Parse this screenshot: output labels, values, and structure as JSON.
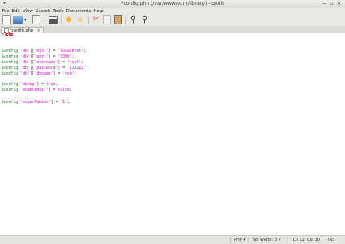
{
  "window": {
    "title": "*config.php (/var/www/vcm/library) - gedit"
  },
  "menu": [
    "File",
    "Edit",
    "View",
    "Search",
    "Tools",
    "Documents",
    "Help"
  ],
  "tab": {
    "label": "*config.php",
    "close": "×"
  },
  "code": {
    "lines": [
      [
        {
          "t": "kw",
          "v": "<?php"
        }
      ],
      [],
      [],
      [
        {
          "t": "var",
          "v": "$config"
        },
        {
          "t": "plain",
          "v": "["
        },
        {
          "t": "str",
          "v": "'db'"
        },
        {
          "t": "plain",
          "v": "]["
        },
        {
          "t": "str",
          "v": "'host'"
        },
        {
          "t": "plain",
          "v": "] = "
        },
        {
          "t": "str",
          "v": "'localhost'"
        },
        {
          "t": "plain",
          "v": ";"
        }
      ],
      [
        {
          "t": "var",
          "v": "$config"
        },
        {
          "t": "plain",
          "v": "["
        },
        {
          "t": "str",
          "v": "'db'"
        },
        {
          "t": "plain",
          "v": "]["
        },
        {
          "t": "str",
          "v": "'port'"
        },
        {
          "t": "plain",
          "v": "] = "
        },
        {
          "t": "str",
          "v": "'3306'"
        },
        {
          "t": "plain",
          "v": ";"
        }
      ],
      [
        {
          "t": "var",
          "v": "$config"
        },
        {
          "t": "plain",
          "v": "["
        },
        {
          "t": "str",
          "v": "'db'"
        },
        {
          "t": "plain",
          "v": "]["
        },
        {
          "t": "str",
          "v": "'username'"
        },
        {
          "t": "plain",
          "v": "] = "
        },
        {
          "t": "str",
          "v": "'root'"
        },
        {
          "t": "plain",
          "v": ";"
        }
      ],
      [
        {
          "t": "var",
          "v": "$config"
        },
        {
          "t": "plain",
          "v": "["
        },
        {
          "t": "str",
          "v": "'db'"
        },
        {
          "t": "plain",
          "v": "]["
        },
        {
          "t": "str",
          "v": "'password'"
        },
        {
          "t": "plain",
          "v": "] = "
        },
        {
          "t": "str",
          "v": "'111222'"
        },
        {
          "t": "plain",
          "v": ";"
        }
      ],
      [
        {
          "t": "var",
          "v": "$config"
        },
        {
          "t": "plain",
          "v": "["
        },
        {
          "t": "str",
          "v": "'db'"
        },
        {
          "t": "plain",
          "v": "]["
        },
        {
          "t": "str",
          "v": "'dbname'"
        },
        {
          "t": "plain",
          "v": "] = "
        },
        {
          "t": "str",
          "v": "'vcm'"
        },
        {
          "t": "plain",
          "v": ";"
        }
      ],
      [],
      [
        {
          "t": "var",
          "v": "$config"
        },
        {
          "t": "plain",
          "v": "["
        },
        {
          "t": "str",
          "v": "'debug'"
        },
        {
          "t": "plain",
          "v": "] = "
        },
        {
          "t": "str",
          "v": "true"
        },
        {
          "t": "plain",
          "v": ";"
        }
      ],
      [
        {
          "t": "var",
          "v": "$config"
        },
        {
          "t": "plain",
          "v": "["
        },
        {
          "t": "str",
          "v": "'enableMail'"
        },
        {
          "t": "plain",
          "v": "] = "
        },
        {
          "t": "str",
          "v": "false"
        },
        {
          "t": "plain",
          "v": ";"
        }
      ],
      [],
      [
        {
          "t": "var",
          "v": "$config"
        },
        {
          "t": "plain",
          "v": "["
        },
        {
          "t": "str",
          "v": "'superAdmins'"
        },
        {
          "t": "plain",
          "v": "] = "
        },
        {
          "t": "str",
          "v": "'1'"
        },
        {
          "t": "plain",
          "v": ";"
        },
        {
          "t": "cursor",
          "v": ""
        }
      ]
    ]
  },
  "status": {
    "language": "PHP ▾",
    "tab_width": "Tab Width:  8 ▾",
    "position": "Ln 12, Col 30",
    "mode": "INS"
  },
  "colors": {
    "keyword": "#c00000",
    "variable": "#2e7d32",
    "string": "#d100c4"
  }
}
